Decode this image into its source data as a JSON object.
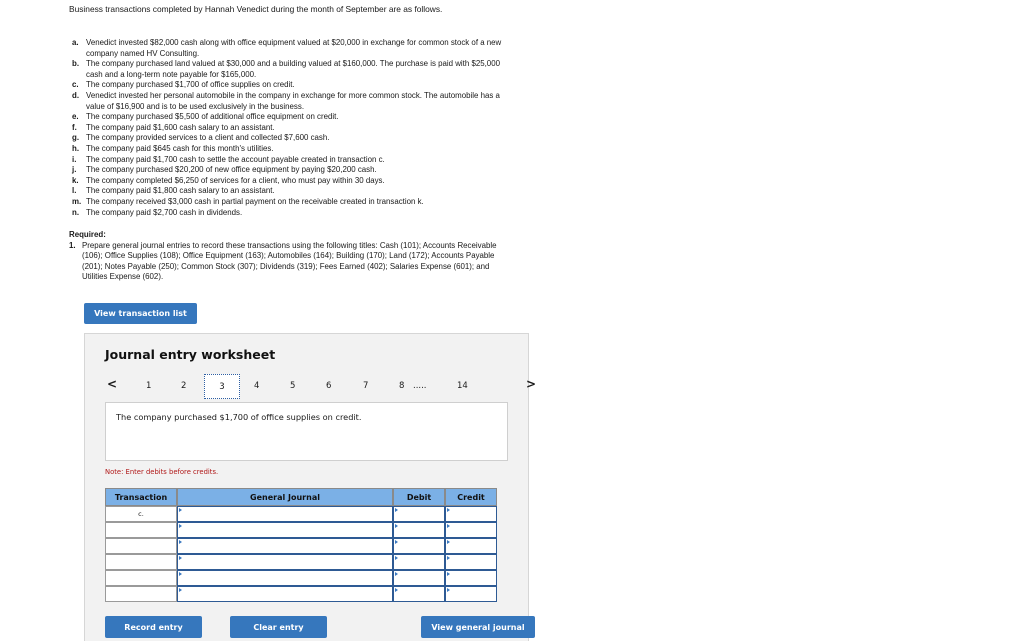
{
  "intro": "Business transactions completed by Hannah Venedict during the month of September are as follows.",
  "transactions": [
    {
      "letter": "a.",
      "text": "Venedict invested $82,000 cash along with office equipment valued at $20,000 in exchange for common stock of a new company named HV Consulting."
    },
    {
      "letter": "b.",
      "text": "The company purchased land valued at $30,000 and a building valued at $160,000. The purchase is paid with $25,000 cash and a long-term note payable for $165,000."
    },
    {
      "letter": "c.",
      "text": "The company purchased $1,700 of office supplies on credit."
    },
    {
      "letter": "d.",
      "text": "Venedict invested her personal automobile in the company in exchange for more common stock. The automobile has a value of $16,900 and is to be used exclusively in the business."
    },
    {
      "letter": "e.",
      "text": "The company purchased $5,500 of additional office equipment on credit."
    },
    {
      "letter": "f.",
      "text": "The company paid $1,600 cash salary to an assistant."
    },
    {
      "letter": "g.",
      "text": "The company provided services to a client and collected $7,600 cash."
    },
    {
      "letter": "h.",
      "text": "The company paid $645 cash for this month's utilities."
    },
    {
      "letter": "i.",
      "text": "The company paid $1,700 cash to settle the account payable created in transaction c."
    },
    {
      "letter": "j.",
      "text": "The company purchased $20,200 of new office equipment by paying $20,200 cash."
    },
    {
      "letter": "k.",
      "text": "The company completed $6,250 of services for a client, who must pay within 30 days."
    },
    {
      "letter": "l.",
      "text": "The company paid $1,800 cash salary to an assistant."
    },
    {
      "letter": "m.",
      "text": "The company received $3,000 cash in partial payment on the receivable created in transaction k."
    },
    {
      "letter": "n.",
      "text": "The company paid $2,700 cash in dividends."
    }
  ],
  "required": {
    "heading": "Required:",
    "number": "1.",
    "text": "Prepare general journal entries to record these transactions using the following titles: Cash (101); Accounts Receivable (106); Office Supplies (108); Office Equipment (163); Automobiles (164); Building (170); Land (172); Accounts Payable (201); Notes Payable (250); Common Stock (307); Dividends (319); Fees Earned (402); Salaries Expense (601); and Utilities Expense (602)."
  },
  "buttons": {
    "view_transaction_list": "View transaction list",
    "record_entry": "Record entry",
    "clear_entry": "Clear entry",
    "view_general_journal": "View general journal"
  },
  "worksheet": {
    "title": "Journal entry worksheet",
    "nav": {
      "prev": "<",
      "next": ">",
      "pages": [
        "1",
        "2",
        "3",
        "4",
        "5",
        "6",
        "7",
        "8"
      ],
      "ellipsis": ".....",
      "last_page": "14",
      "active_page": "3"
    },
    "description": "The company purchased $1,700 of office supplies on credit.",
    "note": "Note: Enter debits before credits.",
    "table": {
      "headers": [
        "Transaction",
        "General Journal",
        "Debit",
        "Credit"
      ],
      "rows": [
        {
          "transaction": "c.",
          "account": "",
          "debit": "",
          "credit": ""
        },
        {
          "transaction": "",
          "account": "",
          "debit": "",
          "credit": ""
        },
        {
          "transaction": "",
          "account": "",
          "debit": "",
          "credit": ""
        },
        {
          "transaction": "",
          "account": "",
          "debit": "",
          "credit": ""
        },
        {
          "transaction": "",
          "account": "",
          "debit": "",
          "credit": ""
        },
        {
          "transaction": "",
          "account": "",
          "debit": "",
          "credit": ""
        }
      ]
    }
  }
}
